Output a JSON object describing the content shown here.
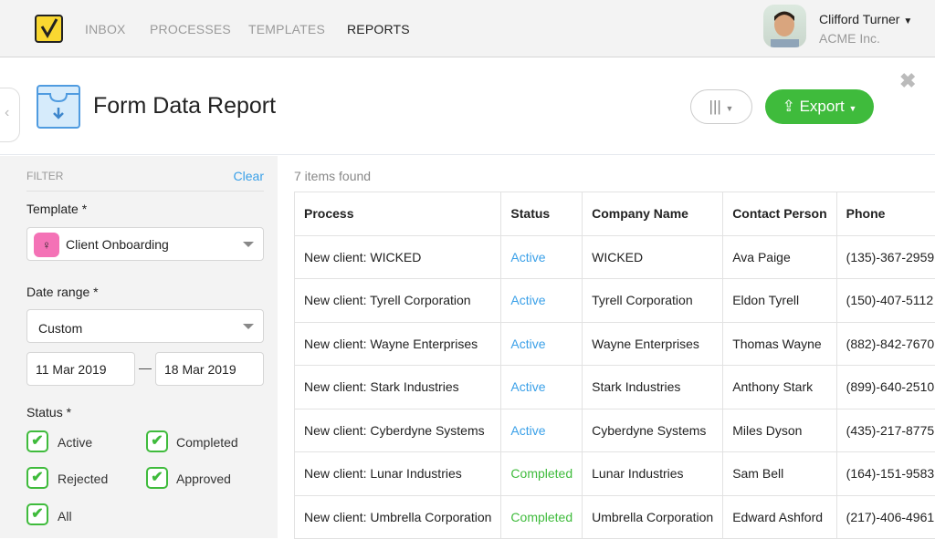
{
  "nav": {
    "items": [
      "INBOX",
      "PROCESSES",
      "TEMPLATES",
      "REPORTS"
    ],
    "active": "REPORTS"
  },
  "user": {
    "name": "Clifford Turner",
    "org": "ACME Inc."
  },
  "header": {
    "title": "Form Data Report",
    "export_label": "Export"
  },
  "filter": {
    "label": "FILTER",
    "clear": "Clear",
    "template_label": "Template *",
    "template_value": "Client Onboarding",
    "date_label": "Date range *",
    "date_value": "Custom",
    "date_from": "11 Mar 2019",
    "date_to": "18 Mar 2019",
    "date_sep": "—",
    "status_label": "Status *",
    "statuses": [
      {
        "label": "Active",
        "checked": true
      },
      {
        "label": "Completed",
        "checked": true
      },
      {
        "label": "Rejected",
        "checked": true
      },
      {
        "label": "Approved",
        "checked": true
      },
      {
        "label": "All",
        "checked": true
      }
    ]
  },
  "colors": {
    "accent": "#3fbb3c",
    "link": "#3aa0e8",
    "logo": "#f9d731",
    "template_icon": "#f472b6"
  },
  "results": {
    "count": "7 items found",
    "columns": [
      "Process",
      "Status",
      "Company Name",
      "Contact Person",
      "Phone"
    ],
    "rows": [
      [
        "New client: WICKED",
        "Active",
        "WICKED",
        "Ava Paige",
        "(135)-367-2959"
      ],
      [
        "New client: Tyrell Corporation",
        "Active",
        "Tyrell Corporation",
        "Eldon Tyrell",
        "(150)-407-5112"
      ],
      [
        "New client: Wayne Enterprises",
        "Active",
        "Wayne Enterprises",
        "Thomas Wayne",
        "(882)-842-7670"
      ],
      [
        "New client: Stark Industries",
        "Active",
        "Stark Industries",
        "Anthony Stark",
        "(899)-640-2510"
      ],
      [
        "New client: Cyberdyne Systems",
        "Active",
        "Cyberdyne Systems",
        "Miles Dyson",
        "(435)-217-8775"
      ],
      [
        "New client: Lunar Industries",
        "Completed",
        "Lunar Industries",
        "Sam Bell",
        "(164)-151-9583"
      ],
      [
        "New client: Umbrella Corporation",
        "Completed",
        "Umbrella Corporation",
        "Edward Ashford",
        "(217)-406-4961"
      ]
    ]
  }
}
